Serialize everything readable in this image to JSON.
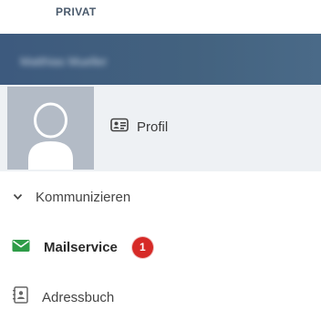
{
  "section": {
    "title": "PRIVAT"
  },
  "user": {
    "name": "Matthias Mueller"
  },
  "profile": {
    "label": "Profil",
    "icon": "id-card-icon"
  },
  "group": {
    "label": "Kommunizieren",
    "icon": "chevron-down-icon"
  },
  "nav": {
    "mail": {
      "label": "Mailservice",
      "icon": "envelope-icon",
      "icon_color": "#2e9c48",
      "badge": "1",
      "badge_color": "#d62a27"
    },
    "address": {
      "label": "Adressbuch",
      "icon": "address-book-icon"
    }
  },
  "colors": {
    "header_bar": "#43627f",
    "profile_bg": "#eef1f4",
    "section_label": "#4a5a6c"
  }
}
